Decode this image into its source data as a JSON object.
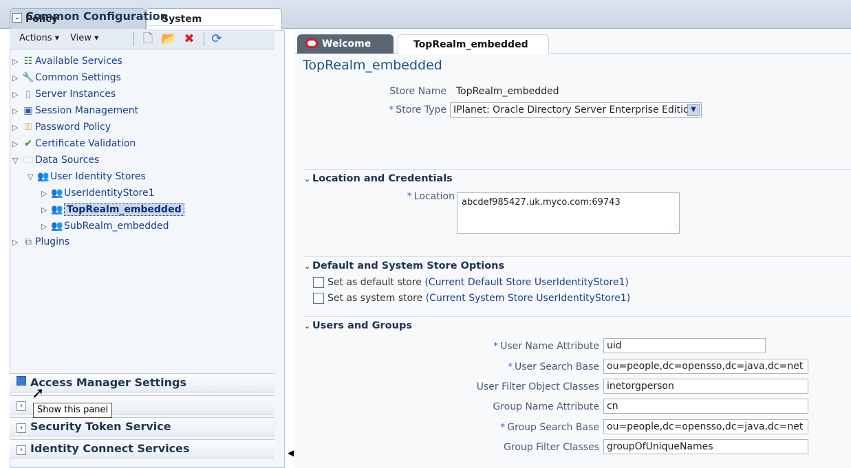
{
  "top_tabs": {
    "policy": "Policy Configuration",
    "system": "System Configuration"
  },
  "left": {
    "accordion_title": "Common Configuration",
    "toolbar": {
      "actions": "Actions ▾",
      "view": "View ▾"
    },
    "tree": [
      {
        "label": "Available Services"
      },
      {
        "label": "Common Settings"
      },
      {
        "label": "Server Instances"
      },
      {
        "label": "Session Management"
      },
      {
        "label": "Password Policy"
      },
      {
        "label": "Certificate Validation"
      },
      {
        "label": "Data Sources"
      },
      {
        "label": "User Identity Stores"
      },
      {
        "label": "UserIdentityStore1"
      },
      {
        "label": "TopRealm_embedded"
      },
      {
        "label": "SubRealm_embedded"
      },
      {
        "label": "Plugins"
      }
    ],
    "panels": {
      "access_manager": "Access Manager Settings",
      "security_token": "Security Token Service",
      "identity_connect": "Identity Connect Services"
    },
    "tooltip": "Show this panel"
  },
  "right": {
    "tabs": {
      "welcome": "Welcome",
      "realm": "TopRealm_embedded"
    },
    "title": "TopRealm_embedded",
    "store_name_label": "Store Name",
    "store_name_value": "TopRealm_embedded",
    "store_type_label": "Store Type",
    "store_type_value": "IPlanet: Oracle Directory Server Enterprise Edition",
    "sections": {
      "location": "Location and Credentials",
      "default": "Default and System Store Options",
      "users": "Users and Groups"
    },
    "location_label": "Location",
    "location_value": "abcdef985427.uk.myco.com:69743",
    "default_store_label": "Set as default store",
    "default_store_note": "(Current Default Store  UserIdentityStore1)",
    "system_store_label": "Set as system store",
    "system_store_note": "(Current System Store  UserIdentityStore1)",
    "fields": {
      "user_name_attr_label": "User Name Attribute",
      "user_name_attr_value": "uid",
      "user_search_base_label": "User Search Base",
      "user_search_base_value": "ou=people,dc=opensso,dc=java,dc=net",
      "user_filter_label": "User Filter Object Classes",
      "user_filter_value": "inetorgperson",
      "group_name_attr_label": "Group Name Attribute",
      "group_name_attr_value": "cn",
      "group_search_base_label": "Group Search Base",
      "group_search_base_value": "ou=people,dc=opensso,dc=java,dc=net",
      "group_filter_label": "Group Filter Classes",
      "group_filter_value": "groupOfUniqueNames"
    },
    "required_marker": "*"
  },
  "icons": [
    "new-icon",
    "open-folder-icon",
    "delete-icon",
    "refresh-icon",
    "services-icon",
    "wrench-icon",
    "server-icon",
    "session-icon",
    "key-icon",
    "certificate-icon",
    "folder-icon",
    "users-icon",
    "plugin-icon",
    "oracle-logo-icon"
  ]
}
